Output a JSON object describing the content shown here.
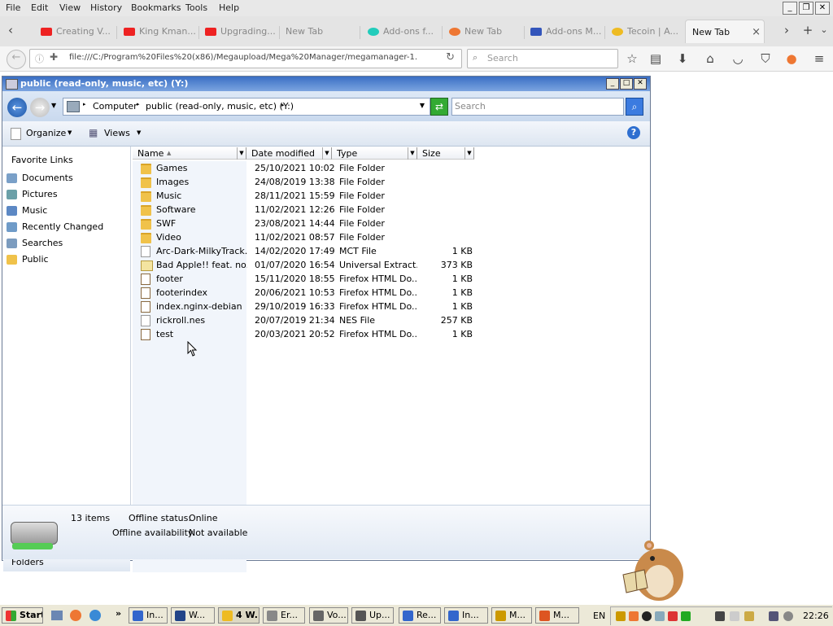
{
  "browser": {
    "menu": [
      "File",
      "Edit",
      "View",
      "History",
      "Bookmarks",
      "Tools",
      "Help"
    ],
    "tabs": [
      {
        "label": "Creating V...",
        "color": "#e22"
      },
      {
        "label": "King Kman...",
        "color": "#e22"
      },
      {
        "label": "Upgrading...",
        "color": "#e22"
      },
      {
        "label": "New Tab",
        "color": ""
      },
      {
        "label": "Add-ons f...",
        "color": "#2cb"
      },
      {
        "label": "New Tab",
        "color": "#e73"
      },
      {
        "label": "Add-ons M...",
        "color": "#35b"
      },
      {
        "label": "Tecoin | A...",
        "color": "#eb2"
      },
      {
        "label": "New Tab",
        "color": ""
      }
    ],
    "active_tab_close": "×",
    "url": "file:///C:/Program%20Files%20(x86)/Megaupload/Mega%20Manager/megamanager-1.",
    "search_placeholder": "Search"
  },
  "explorer": {
    "title": "public (read-only, music, etc) (Y:)",
    "breadcrumb": [
      "Computer",
      "public (read-only, music, etc) (Y:)"
    ],
    "search_placeholder": "Search",
    "toolbar": {
      "organize": "Organize",
      "views": "Views"
    },
    "favorite_links_title": "Favorite Links",
    "favorite_links": [
      {
        "label": "Documents",
        "icon": "documents-icon"
      },
      {
        "label": "Pictures",
        "icon": "pictures-icon"
      },
      {
        "label": "Music",
        "icon": "music-icon"
      },
      {
        "label": "Recently Changed",
        "icon": "recently-changed-icon"
      },
      {
        "label": "Searches",
        "icon": "searches-icon"
      },
      {
        "label": "Public",
        "icon": "folder-icon"
      }
    ],
    "folders_label": "Folders",
    "columns": {
      "name": "Name",
      "date": "Date modified",
      "type": "Type",
      "size": "Size"
    },
    "files": [
      {
        "name": "Games",
        "date": "25/10/2021 10:02",
        "type": "File Folder",
        "size": "",
        "kind": "folder"
      },
      {
        "name": "Images",
        "date": "24/08/2019 13:38",
        "type": "File Folder",
        "size": "",
        "kind": "folder"
      },
      {
        "name": "Music",
        "date": "28/11/2021 15:59",
        "type": "File Folder",
        "size": "",
        "kind": "folder"
      },
      {
        "name": "Software",
        "date": "11/02/2021 12:26",
        "type": "File Folder",
        "size": "",
        "kind": "folder"
      },
      {
        "name": "SWF",
        "date": "23/08/2021 14:44",
        "type": "File Folder",
        "size": "",
        "kind": "folder"
      },
      {
        "name": "Video",
        "date": "11/02/2021 08:57",
        "type": "File Folder",
        "size": "",
        "kind": "folder"
      },
      {
        "name": "Arc-Dark-MilkyTrack...",
        "date": "14/02/2020 17:49",
        "type": "MCT File",
        "size": "1 KB",
        "kind": "file"
      },
      {
        "name": "Bad Apple!! feat. no...",
        "date": "01/07/2020 16:54",
        "type": "Universal Extract...",
        "size": "373 KB",
        "kind": "extr"
      },
      {
        "name": "footer",
        "date": "15/11/2020 18:55",
        "type": "Firefox HTML Do...",
        "size": "1 KB",
        "kind": "htmlf"
      },
      {
        "name": "footerindex",
        "date": "20/06/2021 10:53",
        "type": "Firefox HTML Do...",
        "size": "1 KB",
        "kind": "htmlf"
      },
      {
        "name": "index.nginx-debian",
        "date": "29/10/2019 16:33",
        "type": "Firefox HTML Do...",
        "size": "1 KB",
        "kind": "htmlf"
      },
      {
        "name": "rickroll.nes",
        "date": "20/07/2019 21:34",
        "type": "NES File",
        "size": "257 KB",
        "kind": "file"
      },
      {
        "name": "test",
        "date": "20/03/2021 20:52",
        "type": "Firefox HTML Do...",
        "size": "1 KB",
        "kind": "htmlf"
      }
    ],
    "status": {
      "item_count": "13 items",
      "offline_status_label": "Offline status:",
      "offline_status_value": "Online",
      "offline_avail_label": "Offline availability:",
      "offline_avail_value": "Not available"
    }
  },
  "taskbar": {
    "start": "Start",
    "buttons": [
      {
        "label": "In...",
        "color": "#36c"
      },
      {
        "label": "W...",
        "color": "#248"
      },
      {
        "label": "4 W...",
        "color": "#eb2"
      },
      {
        "label": "Er...",
        "color": "#888"
      },
      {
        "label": "Vo...",
        "color": "#666"
      },
      {
        "label": "Up...",
        "color": "#555"
      },
      {
        "label": "Re...",
        "color": "#36c"
      },
      {
        "label": "In...",
        "color": "#36c"
      },
      {
        "label": "M...",
        "color": "#c90"
      },
      {
        "label": "M...",
        "color": "#d52"
      }
    ],
    "lang": "EN",
    "clock": "22:26"
  }
}
